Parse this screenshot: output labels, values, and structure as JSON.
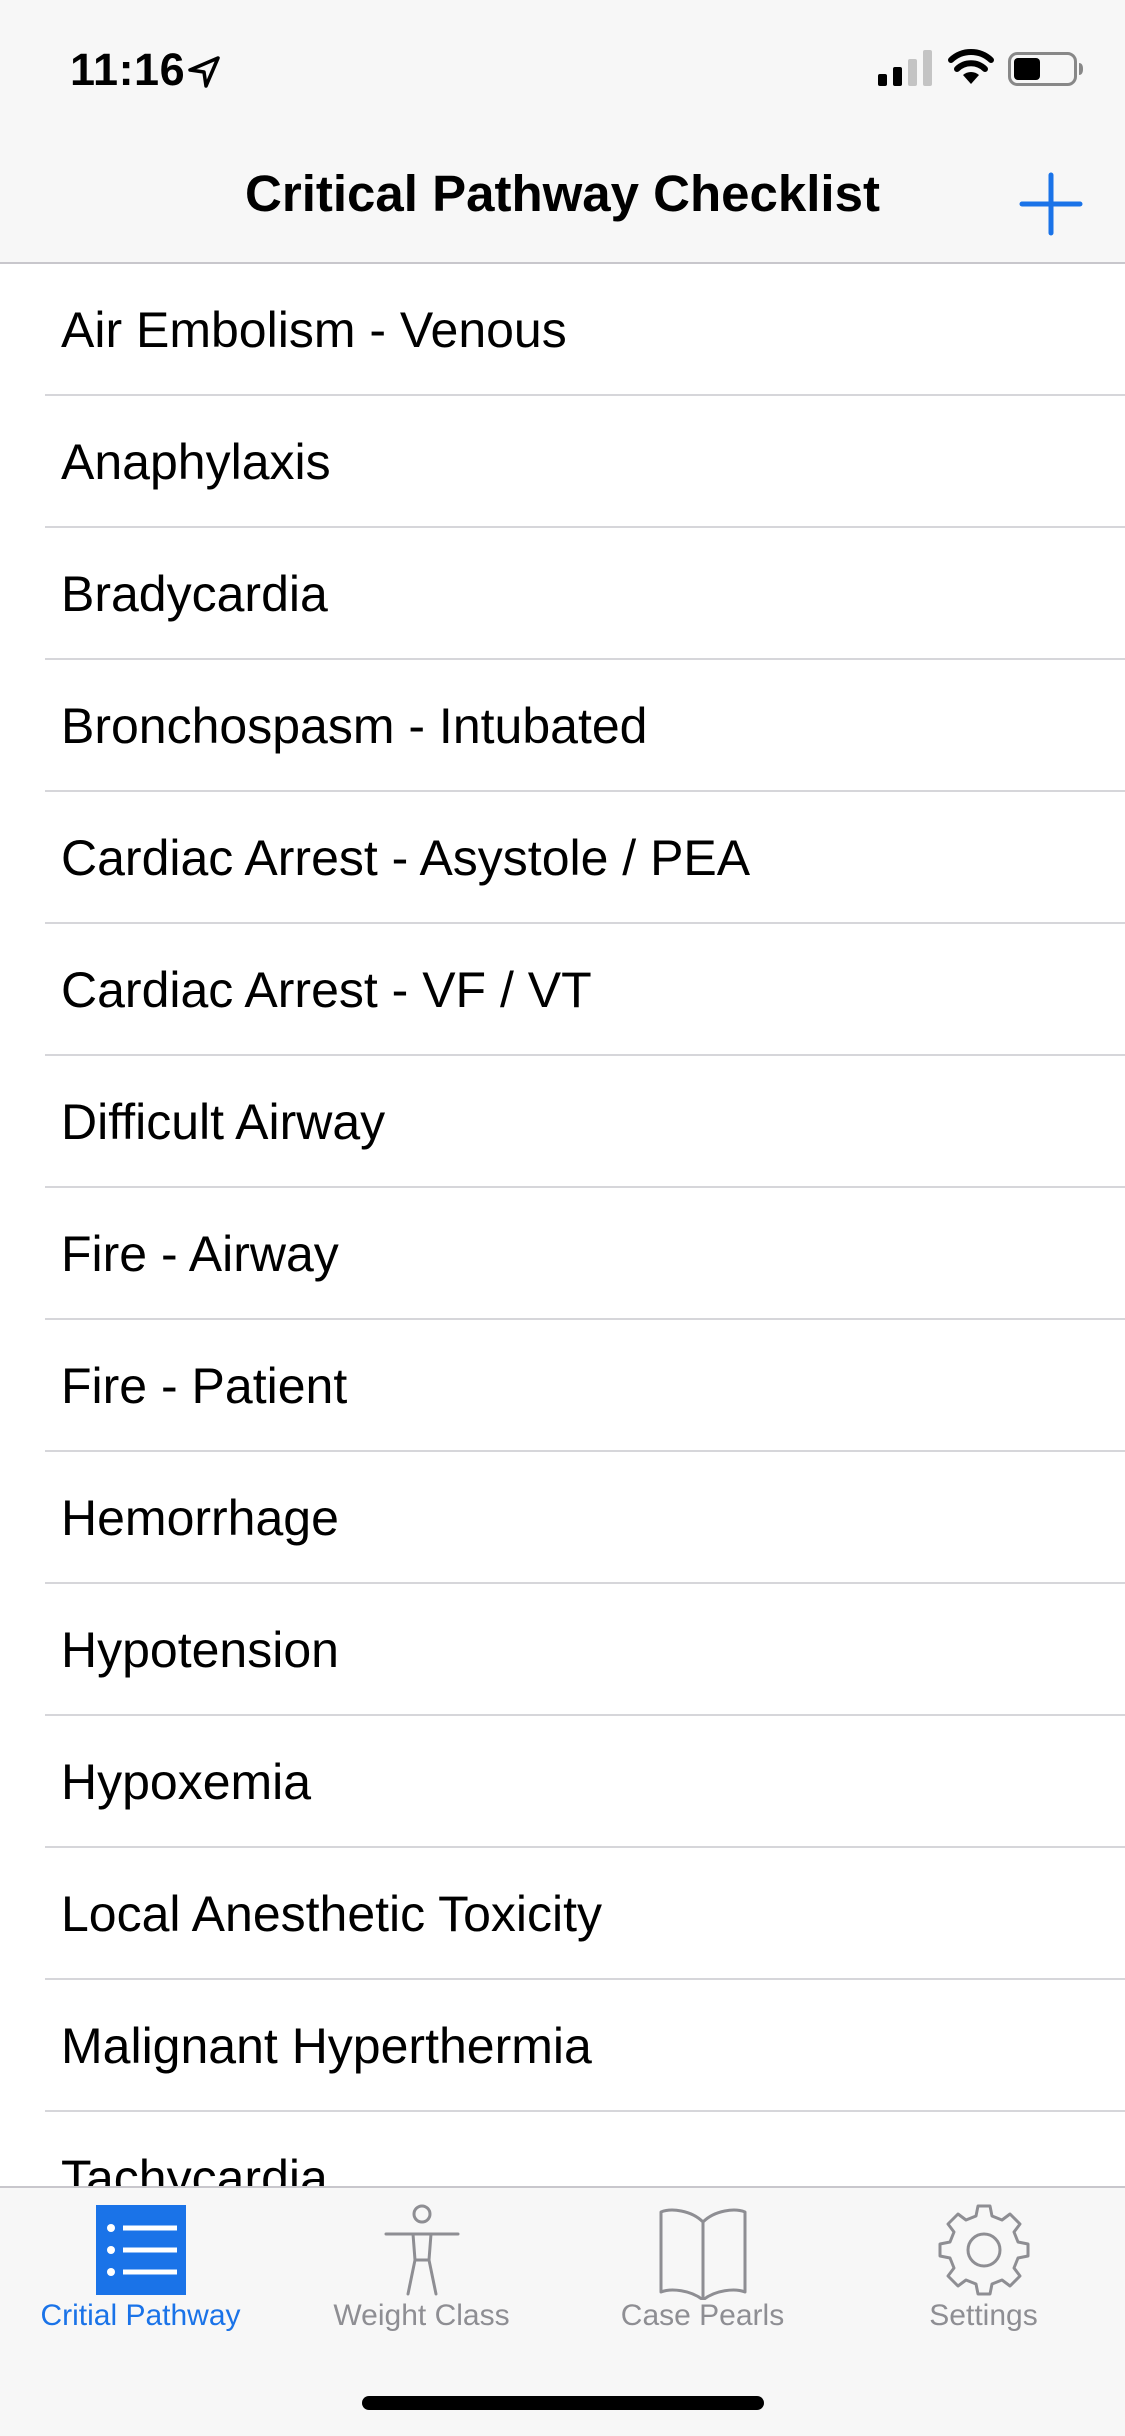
{
  "status_bar": {
    "time": "11:16"
  },
  "nav": {
    "title": "Critical Pathway Checklist",
    "add_icon": "plus-icon"
  },
  "list": {
    "items": [
      {
        "label": "Air Embolism - Venous"
      },
      {
        "label": "Anaphylaxis"
      },
      {
        "label": "Bradycardia"
      },
      {
        "label": "Bronchospasm - Intubated"
      },
      {
        "label": "Cardiac Arrest - Asystole / PEA"
      },
      {
        "label": "Cardiac Arrest - VF / VT"
      },
      {
        "label": "Difficult Airway"
      },
      {
        "label": "Fire - Airway"
      },
      {
        "label": "Fire - Patient"
      },
      {
        "label": "Hemorrhage"
      },
      {
        "label": "Hypotension"
      },
      {
        "label": "Hypoxemia"
      },
      {
        "label": "Local Anesthetic Toxicity"
      },
      {
        "label": "Malignant Hyperthermia"
      },
      {
        "label": "Tachycardia"
      }
    ]
  },
  "tab_bar": {
    "tabs": [
      {
        "label": "Critial Pathway",
        "icon": "list-icon",
        "active": true
      },
      {
        "label": "Weight Class",
        "icon": "person-icon",
        "active": false
      },
      {
        "label": "Case Pearls",
        "icon": "book-icon",
        "active": false
      },
      {
        "label": "Settings",
        "icon": "gear-icon",
        "active": false
      }
    ]
  },
  "colors": {
    "accent": "#1a73e8",
    "inactive": "#8e8e93",
    "bar_background": "#f7f7f7",
    "separator": "#d6d6da"
  }
}
